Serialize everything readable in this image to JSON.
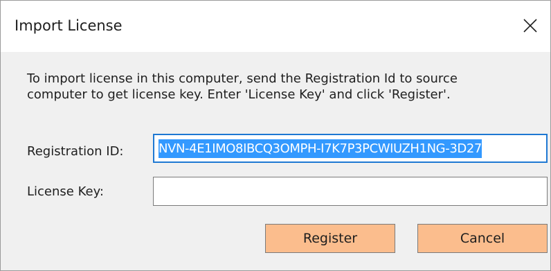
{
  "dialog": {
    "title": "Import License",
    "instructions": "To import license in this computer, send the Registration Id to source\ncomputer to get license key. Enter 'License Key' and click 'Register'.",
    "registration_label": "Registration ID:",
    "registration_value": "NVN-4E1IMO8IBCQ3OMPH-I7K7P3PCWIUZH1NG-3D27",
    "license_key_label": "License Key:",
    "license_key_value": "",
    "register_label": "Register",
    "cancel_label": "Cancel"
  },
  "colors": {
    "button_bg": "#fbbd8d",
    "selection_bg": "#3399ff",
    "focus_border": "#1e78d2",
    "body_bg": "#f0f0f0"
  },
  "icons": {
    "close": "close-icon"
  }
}
